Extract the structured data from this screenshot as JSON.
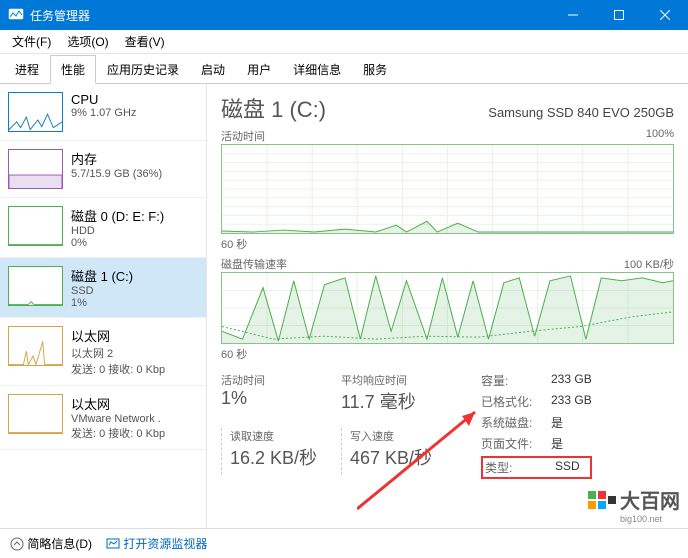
{
  "window": {
    "title": "任务管理器"
  },
  "menu": {
    "file": "文件(F)",
    "options": "选项(O)",
    "view": "查看(V)"
  },
  "tabs": [
    "进程",
    "性能",
    "应用历史记录",
    "启动",
    "用户",
    "详细信息",
    "服务"
  ],
  "selected_tab_index": 1,
  "sidebar": [
    {
      "name": "CPU",
      "sub": "9% 1.07 GHz"
    },
    {
      "name": "内存",
      "sub": "5.7/15.9 GB (36%)"
    },
    {
      "name": "磁盘 0 (D: E: F:)",
      "sub1": "HDD",
      "sub2": "0%"
    },
    {
      "name": "磁盘 1 (C:)",
      "sub1": "SSD",
      "sub2": "1%",
      "selected": true
    },
    {
      "name": "以太网",
      "sub1": "以太网 2",
      "sub2": "发送: 0 接收: 0 Kbp"
    },
    {
      "name": "以太网",
      "sub1": "VMware Network .",
      "sub2": "发送: 0 接收: 0 Kbp"
    }
  ],
  "main": {
    "title": "磁盘 1 (C:)",
    "device": "Samsung SSD 840 EVO 250GB",
    "chart1_left": "活动时间",
    "chart1_right": "100%",
    "chart1_axis": "60 秒",
    "chart2_left": "磁盘传输速率",
    "chart2_right": "100 KB/秒",
    "chart2_axis": "60 秒",
    "stats": {
      "active_time_label": "活动时间",
      "active_time_value": "1%",
      "avg_resp_label": "平均响应时间",
      "avg_resp_value": "11.7 毫秒",
      "read_label": "读取速度",
      "read_value": "16.2 KB/秒",
      "write_label": "写入速度",
      "write_value": "467 KB/秒"
    },
    "props": {
      "capacity_k": "容量:",
      "capacity_v": "233 GB",
      "formatted_k": "已格式化:",
      "formatted_v": "233 GB",
      "system_k": "系统磁盘:",
      "system_v": "是",
      "pagefile_k": "页面文件:",
      "pagefile_v": "是",
      "type_k": "类型:",
      "type_v": "SSD"
    }
  },
  "footer": {
    "fewer": "简略信息(D)",
    "resmon": "打开资源监视器"
  },
  "watermark": {
    "text": "大百网",
    "sub": "big100.net"
  },
  "chart_data": [
    {
      "type": "line",
      "title": "活动时间",
      "xlabel": "60 秒",
      "ylabel": "",
      "ylim": [
        0,
        100
      ],
      "unit": "%",
      "values": [
        2,
        1,
        1,
        3,
        1,
        2,
        1,
        1,
        4,
        2,
        1,
        1,
        1,
        3,
        1,
        2,
        1,
        1,
        5,
        2,
        1,
        1,
        1,
        1,
        8,
        3,
        2,
        1,
        4,
        1,
        1,
        12,
        3,
        1,
        1,
        2,
        1,
        1,
        1,
        1,
        1,
        1,
        1,
        1,
        1,
        1,
        1,
        1,
        1,
        1,
        1,
        1,
        1,
        1,
        1,
        1,
        1,
        1,
        1,
        1
      ]
    },
    {
      "type": "line",
      "title": "磁盘传输速率",
      "xlabel": "60 秒",
      "ylabel": "",
      "ylim": [
        0,
        100
      ],
      "unit": "KB/秒",
      "series": [
        {
          "name": "read",
          "values": [
            20,
            5,
            10,
            5,
            8,
            5,
            6,
            3,
            4,
            5,
            3,
            4,
            3,
            3,
            4,
            3,
            3,
            4,
            3,
            3,
            4,
            3,
            4,
            3,
            3,
            4,
            3,
            4,
            3,
            5,
            3,
            4,
            3,
            4,
            3,
            4,
            3,
            4,
            3,
            5,
            4,
            5,
            4,
            5,
            4,
            6,
            5,
            7,
            6,
            8,
            10,
            15,
            20,
            30,
            40,
            30,
            40,
            35,
            45,
            30
          ]
        },
        {
          "name": "write",
          "values": [
            10,
            3,
            70,
            5,
            90,
            4,
            85,
            3,
            92,
            4,
            60,
            88,
            20,
            95,
            15,
            90,
            25,
            88,
            12,
            94,
            30,
            85,
            18,
            92,
            10,
            96,
            8,
            90,
            20,
            88,
            16,
            92,
            22,
            86,
            28,
            90,
            35,
            94,
            40,
            50,
            60,
            88,
            70,
            92,
            80,
            95,
            85,
            90,
            92,
            96,
            88,
            95,
            92,
            90,
            85,
            95,
            90,
            88,
            92,
            85
          ]
        }
      ]
    }
  ]
}
